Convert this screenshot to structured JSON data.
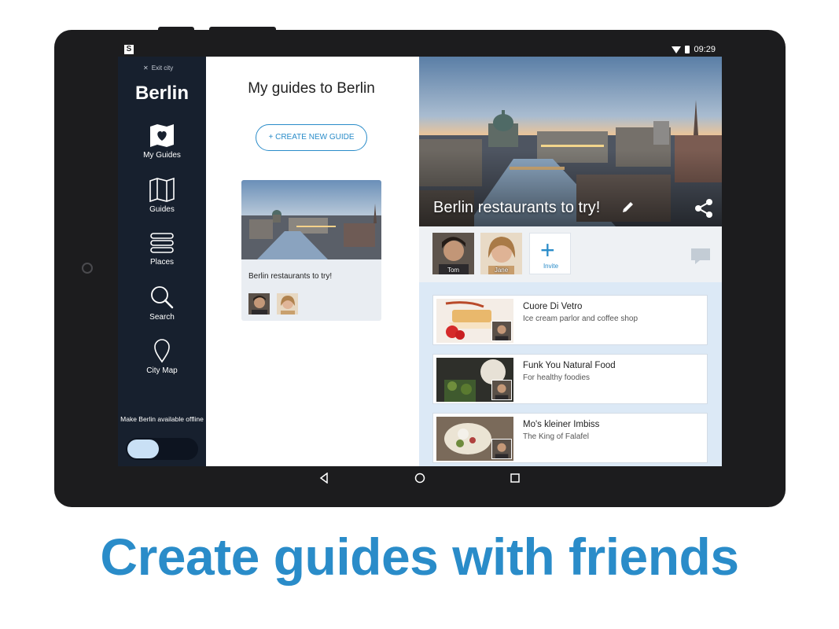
{
  "status": {
    "app_badge": "S",
    "time": "09:29"
  },
  "sidebar": {
    "exit_label": "Exit city",
    "city": "Berlin",
    "items": [
      {
        "label": "My Guides",
        "icon": "map-heart-icon",
        "active": true
      },
      {
        "label": "Guides",
        "icon": "map-icon"
      },
      {
        "label": "Places",
        "icon": "list-icon"
      },
      {
        "label": "Search",
        "icon": "search-icon"
      },
      {
        "label": "City Map",
        "icon": "pin-icon"
      }
    ],
    "offline_label": "Make Berlin available offline",
    "offline_enabled": false
  },
  "middle": {
    "title": "My guides to Berlin",
    "create_button": "+ CREATE NEW GUIDE",
    "guide_card": {
      "title": "Berlin restaurants to try!"
    }
  },
  "detail": {
    "title": "Berlin restaurants to try!",
    "members": [
      {
        "name": "Tom"
      },
      {
        "name": "Jane"
      }
    ],
    "invite_label": "Invite",
    "places": [
      {
        "name": "Cuore Di Vetro",
        "description": "Ice cream parlor and coffee shop"
      },
      {
        "name": "Funk You Natural Food",
        "description": "For healthy foodies"
      },
      {
        "name": "Mo's kleiner Imbiss",
        "description": "The King of Falafel"
      }
    ]
  },
  "tagline": "Create guides with friends",
  "colors": {
    "accent": "#2a8cc9",
    "sidebar": "#17202e",
    "detail_bg": "#dce9f6"
  }
}
